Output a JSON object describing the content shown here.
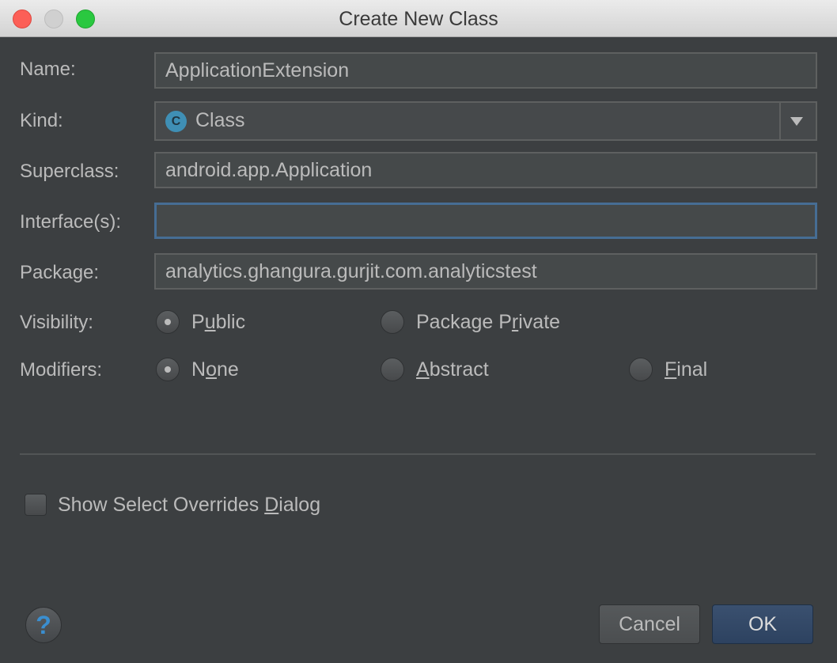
{
  "window": {
    "title": "Create New Class"
  },
  "form": {
    "name": {
      "label": "Name:",
      "value": "ApplicationExtension"
    },
    "kind": {
      "label": "Kind:",
      "value": "Class",
      "icon": "class-icon",
      "icon_letter": "C"
    },
    "superclass": {
      "label": "Superclass:",
      "value": "android.app.Application"
    },
    "interfaces": {
      "label": "Interface(s):",
      "value": ""
    },
    "package": {
      "label": "Package:",
      "value": "analytics.ghangura.gurjit.com.analyticstest"
    },
    "visibility": {
      "label": "Visibility:",
      "options": [
        {
          "pre": "P",
          "mnemonic": "u",
          "post": "blic",
          "checked": true
        },
        {
          "pre": "Package P",
          "mnemonic": "r",
          "post": "ivate",
          "checked": false
        }
      ]
    },
    "modifiers": {
      "label": "Modifiers:",
      "options": [
        {
          "pre": "N",
          "mnemonic": "o",
          "post": "ne",
          "checked": true
        },
        {
          "pre": "",
          "mnemonic": "A",
          "post": "bstract",
          "checked": false
        },
        {
          "pre": "",
          "mnemonic": "F",
          "post": "inal",
          "checked": false
        }
      ]
    }
  },
  "overrides": {
    "pre": "Show Select Overrides ",
    "mnemonic": "D",
    "post": "ialog",
    "checked": false
  },
  "footer": {
    "help_label": "?",
    "cancel_label": "Cancel",
    "ok_label": "OK"
  },
  "colors": {
    "accent": "#466d94",
    "background": "#3c3f41",
    "text": "#bbbbbb",
    "ok_button": "#2d4260"
  }
}
